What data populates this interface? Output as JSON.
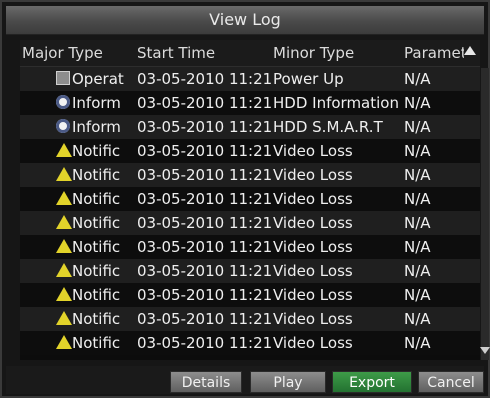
{
  "window": {
    "title": "View Log"
  },
  "table": {
    "headers": [
      "Major Type",
      "Start Time",
      "Minor Type",
      "Parameter"
    ],
    "rows": [
      {
        "icon": "operation-icon",
        "type": "Operat",
        "time": "03-05-2010 11:21:",
        "minor": "Power Up",
        "param": "N/A"
      },
      {
        "icon": "information-icon",
        "type": "Inform",
        "time": "03-05-2010 11:21:",
        "minor": "HDD Information",
        "param": "N/A"
      },
      {
        "icon": "information-icon",
        "type": "Inform",
        "time": "03-05-2010 11:21:",
        "minor": "HDD S.M.A.R.T",
        "param": "N/A"
      },
      {
        "icon": "warning-icon",
        "type": "Notific",
        "time": "03-05-2010 11:21:",
        "minor": "Video Loss",
        "param": "N/A"
      },
      {
        "icon": "warning-icon",
        "type": "Notific",
        "time": "03-05-2010 11:21:",
        "minor": "Video Loss",
        "param": "N/A"
      },
      {
        "icon": "warning-icon",
        "type": "Notific",
        "time": "03-05-2010 11:21:",
        "minor": "Video Loss",
        "param": "N/A"
      },
      {
        "icon": "warning-icon",
        "type": "Notific",
        "time": "03-05-2010 11:21:",
        "minor": "Video Loss",
        "param": "N/A"
      },
      {
        "icon": "warning-icon",
        "type": "Notific",
        "time": "03-05-2010 11:21:",
        "minor": "Video Loss",
        "param": "N/A"
      },
      {
        "icon": "warning-icon",
        "type": "Notific",
        "time": "03-05-2010 11:21:",
        "minor": "Video Loss",
        "param": "N/A"
      },
      {
        "icon": "warning-icon",
        "type": "Notific",
        "time": "03-05-2010 11:21:",
        "minor": "Video Loss",
        "param": "N/A"
      },
      {
        "icon": "warning-icon",
        "type": "Notific",
        "time": "03-05-2010 11:21:",
        "minor": "Video Loss",
        "param": "N/A"
      },
      {
        "icon": "warning-icon",
        "type": "Notific",
        "time": "03-05-2010 11:21:",
        "minor": "Video Loss",
        "param": "N/A"
      }
    ]
  },
  "buttons": {
    "details": "Details",
    "play": "Play",
    "export": "Export",
    "cancel": "Cancel"
  },
  "colors": {
    "primary_button": "#2f8a3c",
    "warning_icon": "#e2d32a"
  }
}
